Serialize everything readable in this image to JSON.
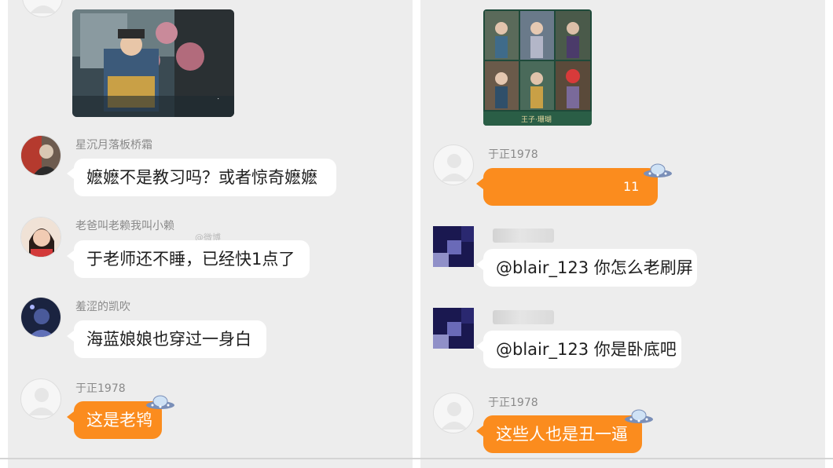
{
  "left_chat": {
    "messages": [
      {
        "username": "星沉月落板桥霜",
        "text": "嬷嬷不是教习吗？或者惊奇嬷嬷"
      },
      {
        "username": "老爸叫老赖我叫小赖",
        "text": "于老师还不睡，已经快1点了"
      },
      {
        "username": "羞涩的凯吹",
        "text": "海蓝娘娘也穿过一身白"
      },
      {
        "username": "于正1978",
        "text": "这是老鸨"
      }
    ],
    "watermark": "@微博"
  },
  "right_chat": {
    "messages": [
      {
        "username": "于正1978",
        "text": "11"
      },
      {
        "username": "",
        "text": "@blair_123 你怎么老刷屏"
      },
      {
        "username": "",
        "text": "@blair_123 你是卧底吧"
      },
      {
        "username": "于正1978",
        "text": "这些人也是丑一逼"
      }
    ],
    "poster_caption": "王子·珊瑚"
  },
  "colors": {
    "accent_bubble": "#fb8c1e",
    "panel_bg": "#ededed",
    "bubble": "#ffffff"
  },
  "icons": [
    "default-avatar-icon",
    "ufo-sticker-icon"
  ]
}
